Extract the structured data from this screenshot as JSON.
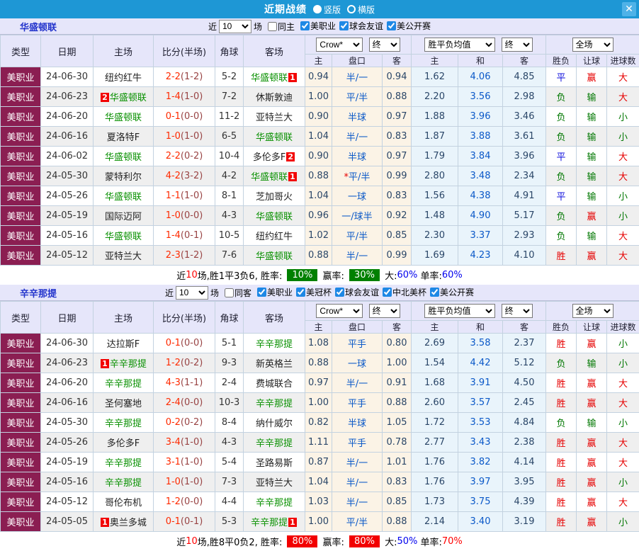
{
  "titlebar": {
    "title": "近期战绩",
    "vertical": "竖版",
    "horizontal": "横版",
    "close": "✕"
  },
  "filter_labels": {
    "near": "近",
    "count": "10",
    "games": "场"
  },
  "table_header": {
    "type": "类型",
    "date": "日期",
    "home": "主场",
    "score": "比分(半场)",
    "corner": "角球",
    "away": "客场",
    "asian_select": "Crow*",
    "asian_final": "终",
    "europe_select": "胜平负均值",
    "europe_final": "终",
    "result_select": "全场",
    "sub_home": "主",
    "sub_handicap": "盘口",
    "sub_away": "客",
    "sub_ehome": "主",
    "sub_draw": "和",
    "sub_eaway": "客",
    "sub_wdl": "胜负",
    "sub_let": "让球",
    "sub_goals": "进球数"
  },
  "colors": {
    "accent_blue": "#1e97d5",
    "header_lavender": "#e6e6fa",
    "league_maroon": "#8b1e52",
    "self_team_green": "#089000",
    "win_red": "#e60000",
    "lose_green": "#007700",
    "draw_blue": "#1111dd",
    "asian_bg": "#fbf3e6",
    "europe_bg": "#e9f4fb"
  },
  "sections": [
    {
      "team": "华盛顿联",
      "same_label": "同主",
      "same_checked": false,
      "competitions": [
        "美职业",
        "球会友谊",
        "美公开赛"
      ],
      "rows": [
        {
          "league": "美职业",
          "date": "24-06-30",
          "home": "纽约红牛",
          "home_self": false,
          "home_badge": "",
          "score": "2-2",
          "half": "(1-2)",
          "corner": "5-2",
          "away": "华盛顿联",
          "away_self": true,
          "away_badge": "1",
          "asian": [
            "0.94",
            "半/一",
            "0.94"
          ],
          "europe": [
            "1.62",
            "4.06",
            "4.85"
          ],
          "wdl": [
            "平",
            "d"
          ],
          "let": [
            "赢",
            "w"
          ],
          "goal": [
            "大",
            "w"
          ]
        },
        {
          "league": "美职业",
          "date": "24-06-23",
          "home": "华盛顿联",
          "home_self": true,
          "home_badge": "2",
          "score": "1-4",
          "half": "(1-0)",
          "corner": "7-2",
          "away": "休斯敦迪",
          "away_self": false,
          "away_badge": "",
          "asian": [
            "1.00",
            "平/半",
            "0.88"
          ],
          "europe": [
            "2.20",
            "3.56",
            "2.98"
          ],
          "wdl": [
            "负",
            "l"
          ],
          "let": [
            "输",
            "l"
          ],
          "goal": [
            "大",
            "w"
          ]
        },
        {
          "league": "美职业",
          "date": "24-06-20",
          "home": "华盛顿联",
          "home_self": true,
          "home_badge": "",
          "score": "0-1",
          "half": "(0-0)",
          "corner": "11-2",
          "away": "亚特兰大",
          "away_self": false,
          "away_badge": "",
          "asian": [
            "0.90",
            "半球",
            "0.97"
          ],
          "europe": [
            "1.88",
            "3.96",
            "3.46"
          ],
          "wdl": [
            "负",
            "l"
          ],
          "let": [
            "输",
            "l"
          ],
          "goal": [
            "小",
            "l"
          ]
        },
        {
          "league": "美职业",
          "date": "24-06-16",
          "home": "夏洛特F",
          "home_self": false,
          "home_badge": "",
          "score": "1-0",
          "half": "(1-0)",
          "corner": "6-5",
          "away": "华盛顿联",
          "away_self": true,
          "away_badge": "",
          "asian": [
            "1.04",
            "半/一",
            "0.83"
          ],
          "europe": [
            "1.87",
            "3.88",
            "3.61"
          ],
          "wdl": [
            "负",
            "l"
          ],
          "let": [
            "输",
            "l"
          ],
          "goal": [
            "小",
            "l"
          ]
        },
        {
          "league": "美职业",
          "date": "24-06-02",
          "home": "华盛顿联",
          "home_self": true,
          "home_badge": "",
          "score": "2-2",
          "half": "(0-2)",
          "corner": "10-4",
          "away": "多伦多F",
          "away_self": false,
          "away_badge": "2",
          "asian": [
            "0.90",
            "半球",
            "0.97"
          ],
          "europe": [
            "1.79",
            "3.84",
            "3.96"
          ],
          "wdl": [
            "平",
            "d"
          ],
          "let": [
            "输",
            "l"
          ],
          "goal": [
            "大",
            "w"
          ]
        },
        {
          "league": "美职业",
          "date": "24-05-30",
          "home": "蒙特利尔",
          "home_self": false,
          "home_badge": "",
          "score": "4-2",
          "half": "(3-2)",
          "corner": "4-2",
          "away": "华盛顿联",
          "away_self": true,
          "away_badge": "1",
          "asian": [
            "0.88",
            "*平/半",
            "0.99"
          ],
          "europe": [
            "2.80",
            "3.48",
            "2.34"
          ],
          "wdl": [
            "负",
            "l"
          ],
          "let": [
            "输",
            "l"
          ],
          "goal": [
            "大",
            "w"
          ]
        },
        {
          "league": "美职业",
          "date": "24-05-26",
          "home": "华盛顿联",
          "home_self": true,
          "home_badge": "",
          "score": "1-1",
          "half": "(1-0)",
          "corner": "8-1",
          "away": "芝加哥火",
          "away_self": false,
          "away_badge": "",
          "asian": [
            "1.04",
            "一球",
            "0.83"
          ],
          "europe": [
            "1.56",
            "4.38",
            "4.91"
          ],
          "wdl": [
            "平",
            "d"
          ],
          "let": [
            "输",
            "l"
          ],
          "goal": [
            "小",
            "l"
          ]
        },
        {
          "league": "美职业",
          "date": "24-05-19",
          "home": "国际迈阿",
          "home_self": false,
          "home_badge": "",
          "score": "1-0",
          "half": "(0-0)",
          "corner": "4-3",
          "away": "华盛顿联",
          "away_self": true,
          "away_badge": "",
          "asian": [
            "0.96",
            "一/球半",
            "0.92"
          ],
          "europe": [
            "1.48",
            "4.90",
            "5.17"
          ],
          "wdl": [
            "负",
            "l"
          ],
          "let": [
            "赢",
            "w"
          ],
          "goal": [
            "小",
            "l"
          ]
        },
        {
          "league": "美职业",
          "date": "24-05-16",
          "home": "华盛顿联",
          "home_self": true,
          "home_badge": "",
          "score": "1-4",
          "half": "(0-1)",
          "corner": "10-5",
          "away": "纽约红牛",
          "away_self": false,
          "away_badge": "",
          "asian": [
            "1.02",
            "平/半",
            "0.85"
          ],
          "europe": [
            "2.30",
            "3.37",
            "2.93"
          ],
          "wdl": [
            "负",
            "l"
          ],
          "let": [
            "输",
            "l"
          ],
          "goal": [
            "大",
            "w"
          ]
        },
        {
          "league": "美职业",
          "date": "24-05-12",
          "home": "亚特兰大",
          "home_self": false,
          "home_badge": "",
          "score": "2-3",
          "half": "(1-2)",
          "corner": "7-6",
          "away": "华盛顿联",
          "away_self": true,
          "away_badge": "",
          "asian": [
            "0.88",
            "半/一",
            "0.99"
          ],
          "europe": [
            "1.69",
            "4.23",
            "4.10"
          ],
          "wdl": [
            "胜",
            "w"
          ],
          "let": [
            "赢",
            "w"
          ],
          "goal": [
            "大",
            "w"
          ]
        }
      ],
      "summary": [
        {
          "t": "近"
        },
        {
          "t": "10",
          "c": "red"
        },
        {
          "t": "场,胜1平3负6, 胜率: "
        },
        {
          "t": "10%",
          "bg": "green"
        },
        {
          "t": " 赢率: "
        },
        {
          "t": "30%",
          "bg": "green"
        },
        {
          "t": " 大:"
        },
        {
          "t": "60%",
          "c": "blue"
        },
        {
          "t": " 单率:"
        },
        {
          "t": "60%",
          "c": "blue"
        }
      ]
    },
    {
      "team": "辛辛那提",
      "same_label": "同客",
      "same_checked": false,
      "competitions": [
        "美职业",
        "美冠杯",
        "球会友谊",
        "中北美杯",
        "美公开赛"
      ],
      "rows": [
        {
          "league": "美职业",
          "date": "24-06-30",
          "home": "达拉斯F",
          "home_self": false,
          "home_badge": "",
          "score": "0-1",
          "half": "(0-0)",
          "corner": "5-1",
          "away": "辛辛那提",
          "away_self": true,
          "away_badge": "",
          "asian": [
            "1.08",
            "平手",
            "0.80"
          ],
          "europe": [
            "2.69",
            "3.58",
            "2.37"
          ],
          "wdl": [
            "胜",
            "w"
          ],
          "let": [
            "赢",
            "w"
          ],
          "goal": [
            "小",
            "l"
          ]
        },
        {
          "league": "美职业",
          "date": "24-06-23",
          "home": "辛辛那提",
          "home_self": true,
          "home_badge": "1",
          "score": "1-2",
          "half": "(0-2)",
          "corner": "9-3",
          "away": "新英格兰",
          "away_self": false,
          "away_badge": "",
          "asian": [
            "0.88",
            "一球",
            "1.00"
          ],
          "europe": [
            "1.54",
            "4.42",
            "5.12"
          ],
          "wdl": [
            "负",
            "l"
          ],
          "let": [
            "输",
            "l"
          ],
          "goal": [
            "小",
            "l"
          ]
        },
        {
          "league": "美职业",
          "date": "24-06-20",
          "home": "辛辛那提",
          "home_self": true,
          "home_badge": "",
          "score": "4-3",
          "half": "(1-1)",
          "corner": "2-4",
          "away": "费城联合",
          "away_self": false,
          "away_badge": "",
          "asian": [
            "0.97",
            "半/一",
            "0.91"
          ],
          "europe": [
            "1.68",
            "3.91",
            "4.50"
          ],
          "wdl": [
            "胜",
            "w"
          ],
          "let": [
            "赢",
            "w"
          ],
          "goal": [
            "大",
            "w"
          ]
        },
        {
          "league": "美职业",
          "date": "24-06-16",
          "home": "圣何塞地",
          "home_self": false,
          "home_badge": "",
          "score": "2-4",
          "half": "(0-0)",
          "corner": "10-3",
          "away": "辛辛那提",
          "away_self": true,
          "away_badge": "",
          "asian": [
            "1.00",
            "平手",
            "0.88"
          ],
          "europe": [
            "2.60",
            "3.57",
            "2.45"
          ],
          "wdl": [
            "胜",
            "w"
          ],
          "let": [
            "赢",
            "w"
          ],
          "goal": [
            "大",
            "w"
          ]
        },
        {
          "league": "美职业",
          "date": "24-05-30",
          "home": "辛辛那提",
          "home_self": true,
          "home_badge": "",
          "score": "0-2",
          "half": "(0-2)",
          "corner": "8-4",
          "away": "纳什威尔",
          "away_self": false,
          "away_badge": "",
          "asian": [
            "0.82",
            "半球",
            "1.05"
          ],
          "europe": [
            "1.72",
            "3.53",
            "4.84"
          ],
          "wdl": [
            "负",
            "l"
          ],
          "let": [
            "输",
            "l"
          ],
          "goal": [
            "小",
            "l"
          ]
        },
        {
          "league": "美职业",
          "date": "24-05-26",
          "home": "多伦多F",
          "home_self": false,
          "home_badge": "",
          "score": "3-4",
          "half": "(1-0)",
          "corner": "4-3",
          "away": "辛辛那提",
          "away_self": true,
          "away_badge": "",
          "asian": [
            "1.11",
            "平手",
            "0.78"
          ],
          "europe": [
            "2.77",
            "3.43",
            "2.38"
          ],
          "wdl": [
            "胜",
            "w"
          ],
          "let": [
            "赢",
            "w"
          ],
          "goal": [
            "大",
            "w"
          ]
        },
        {
          "league": "美职业",
          "date": "24-05-19",
          "home": "辛辛那提",
          "home_self": true,
          "home_badge": "",
          "score": "3-1",
          "half": "(1-0)",
          "corner": "5-4",
          "away": "圣路易斯",
          "away_self": false,
          "away_badge": "",
          "asian": [
            "0.87",
            "半/一",
            "1.01"
          ],
          "europe": [
            "1.76",
            "3.82",
            "4.14"
          ],
          "wdl": [
            "胜",
            "w"
          ],
          "let": [
            "赢",
            "w"
          ],
          "goal": [
            "大",
            "w"
          ]
        },
        {
          "league": "美职业",
          "date": "24-05-16",
          "home": "辛辛那提",
          "home_self": true,
          "home_badge": "",
          "score": "1-0",
          "half": "(1-0)",
          "corner": "7-3",
          "away": "亚特兰大",
          "away_self": false,
          "away_badge": "",
          "asian": [
            "1.04",
            "半/一",
            "0.83"
          ],
          "europe": [
            "1.76",
            "3.97",
            "3.95"
          ],
          "wdl": [
            "胜",
            "w"
          ],
          "let": [
            "赢",
            "w"
          ],
          "goal": [
            "小",
            "l"
          ]
        },
        {
          "league": "美职业",
          "date": "24-05-12",
          "home": "哥伦布机",
          "home_self": false,
          "home_badge": "",
          "score": "1-2",
          "half": "(0-0)",
          "corner": "4-4",
          "away": "辛辛那提",
          "away_self": true,
          "away_badge": "",
          "asian": [
            "1.03",
            "半/一",
            "0.85"
          ],
          "europe": [
            "1.73",
            "3.75",
            "4.39"
          ],
          "wdl": [
            "胜",
            "w"
          ],
          "let": [
            "赢",
            "w"
          ],
          "goal": [
            "大",
            "w"
          ]
        },
        {
          "league": "美职业",
          "date": "24-05-05",
          "home": "奥兰多城",
          "home_self": false,
          "home_badge": "1",
          "score": "0-1",
          "half": "(0-1)",
          "corner": "5-3",
          "away": "辛辛那提",
          "away_self": true,
          "away_badge": "1",
          "asian": [
            "1.00",
            "平/半",
            "0.88"
          ],
          "europe": [
            "2.14",
            "3.40",
            "3.19"
          ],
          "wdl": [
            "胜",
            "w"
          ],
          "let": [
            "赢",
            "w"
          ],
          "goal": [
            "小",
            "l"
          ]
        }
      ],
      "summary": [
        {
          "t": "近"
        },
        {
          "t": "10",
          "c": "red"
        },
        {
          "t": "场,胜8平0负2, 胜率: "
        },
        {
          "t": "80%",
          "bg": "red"
        },
        {
          "t": " 赢率: "
        },
        {
          "t": "80%",
          "bg": "red"
        },
        {
          "t": " 大:"
        },
        {
          "t": "50%",
          "c": "blue"
        },
        {
          "t": " 单率:"
        },
        {
          "t": "70%",
          "c": "red"
        }
      ]
    }
  ]
}
